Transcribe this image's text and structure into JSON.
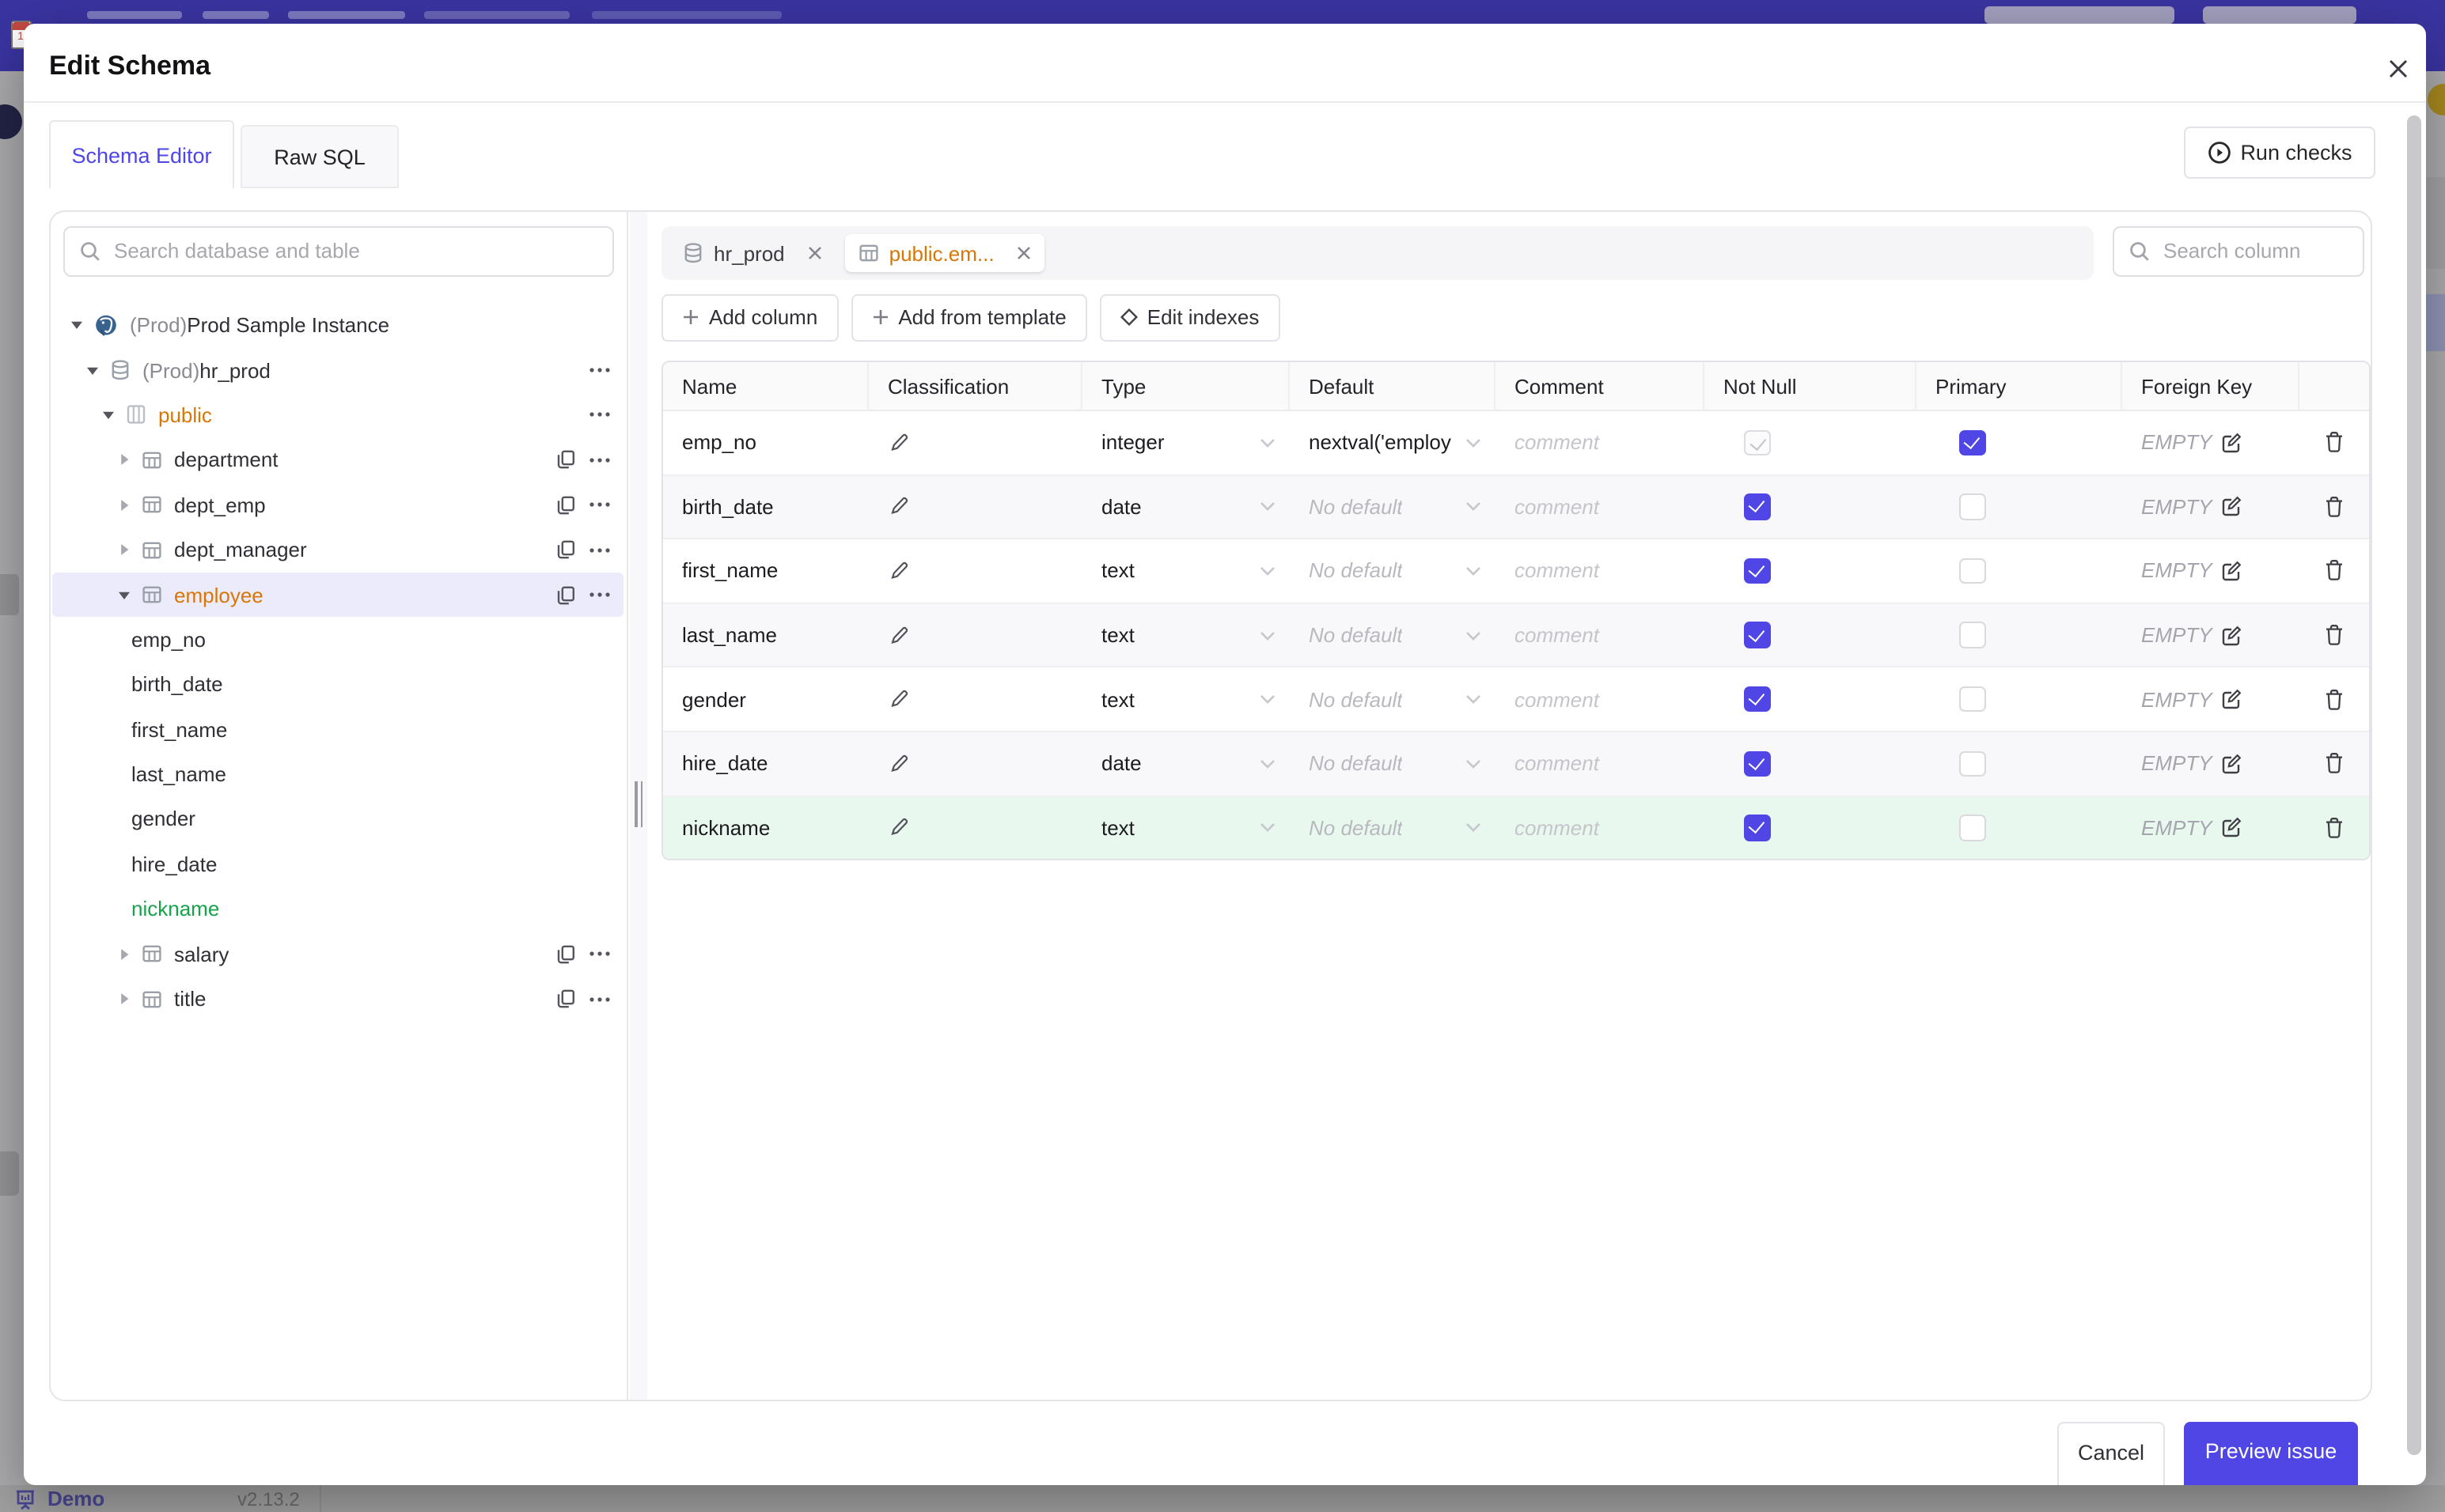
{
  "backdrop": {
    "demo_label": "Demo",
    "version": "v2.13.2",
    "banner_color": "#3a34a2"
  },
  "modal": {
    "title": "Edit Schema",
    "tabs": [
      {
        "label": "Schema Editor",
        "active": true
      },
      {
        "label": "Raw SQL",
        "active": false
      }
    ],
    "run_checks_label": "Run checks",
    "footer": {
      "cancel": "Cancel",
      "preview": "Preview issue"
    }
  },
  "sidebar": {
    "search_placeholder": "Search database and table",
    "tree": [
      {
        "type": "instance",
        "icon": "postgres-icon",
        "prefix": "(Prod) ",
        "label": "Prod Sample Instance",
        "expanded": true
      },
      {
        "type": "database",
        "icon": "database-icon",
        "prefix": "(Prod) ",
        "label": "hr_prod",
        "expanded": true,
        "dots": true
      },
      {
        "type": "schema",
        "icon": "schema-icon",
        "label": "public",
        "expanded": true,
        "dots": true,
        "highlight": "orange"
      },
      {
        "type": "table",
        "icon": "table-icon",
        "label": "department",
        "copy": true,
        "dots": true
      },
      {
        "type": "table",
        "icon": "table-icon",
        "label": "dept_emp",
        "copy": true,
        "dots": true
      },
      {
        "type": "table",
        "icon": "table-icon",
        "label": "dept_manager",
        "copy": true,
        "dots": true
      },
      {
        "type": "table",
        "icon": "table-icon",
        "label": "employee",
        "expanded": true,
        "selected": true,
        "highlight": "orange",
        "copy": true,
        "dots": true
      },
      {
        "type": "column",
        "label": "emp_no"
      },
      {
        "type": "column",
        "label": "birth_date"
      },
      {
        "type": "column",
        "label": "first_name"
      },
      {
        "type": "column",
        "label": "last_name"
      },
      {
        "type": "column",
        "label": "gender"
      },
      {
        "type": "column",
        "label": "hire_date"
      },
      {
        "type": "column",
        "label": "nickname",
        "highlight": "green"
      },
      {
        "type": "table",
        "icon": "table-icon",
        "label": "salary",
        "copy": true,
        "dots": true
      },
      {
        "type": "table",
        "icon": "table-icon",
        "label": "title",
        "copy": true,
        "dots": true
      }
    ]
  },
  "editor": {
    "chips": [
      {
        "icon": "database-icon",
        "label": "hr_prod",
        "active": false
      },
      {
        "icon": "table-icon",
        "label": "public.em...",
        "active": true,
        "highlight": "orange"
      }
    ],
    "column_search_placeholder": "Search column",
    "actions": [
      {
        "icon": "plus-icon",
        "label": "Add column"
      },
      {
        "icon": "plus-icon",
        "label": "Add from template"
      },
      {
        "icon": "diamond-icon",
        "label": "Edit indexes"
      }
    ],
    "table": {
      "headers": [
        "Name",
        "Classification",
        "Type",
        "Default",
        "Comment",
        "Not Null",
        "Primary",
        "Foreign Key",
        ""
      ],
      "comment_placeholder": "comment",
      "foreign_key_empty": "EMPTY",
      "rows": [
        {
          "name": "emp_no",
          "type": "integer",
          "default": "nextval('employ",
          "default_is_placeholder": false,
          "not_null": true,
          "not_null_disabled": true,
          "primary": true,
          "striped": false,
          "new": false
        },
        {
          "name": "birth_date",
          "type": "date",
          "default": "No default",
          "default_is_placeholder": true,
          "not_null": true,
          "not_null_disabled": false,
          "primary": false,
          "striped": true,
          "new": false
        },
        {
          "name": "first_name",
          "type": "text",
          "default": "No default",
          "default_is_placeholder": true,
          "not_null": true,
          "not_null_disabled": false,
          "primary": false,
          "striped": false,
          "new": false
        },
        {
          "name": "last_name",
          "type": "text",
          "default": "No default",
          "default_is_placeholder": true,
          "not_null": true,
          "not_null_disabled": false,
          "primary": false,
          "striped": true,
          "new": false
        },
        {
          "name": "gender",
          "type": "text",
          "default": "No default",
          "default_is_placeholder": true,
          "not_null": true,
          "not_null_disabled": false,
          "primary": false,
          "striped": false,
          "new": false
        },
        {
          "name": "hire_date",
          "type": "date",
          "default": "No default",
          "default_is_placeholder": true,
          "not_null": true,
          "not_null_disabled": false,
          "primary": false,
          "striped": true,
          "new": false
        },
        {
          "name": "nickname",
          "type": "text",
          "default": "No default",
          "default_is_placeholder": true,
          "not_null": true,
          "not_null_disabled": false,
          "primary": false,
          "striped": false,
          "new": true
        }
      ]
    }
  },
  "colors": {
    "accent": "#4f46e5",
    "modified_orange": "#d97706",
    "created_green": "#16a34a",
    "new_row_bg": "#e9f8ef",
    "selected_row_bg": "#ecebfb"
  }
}
